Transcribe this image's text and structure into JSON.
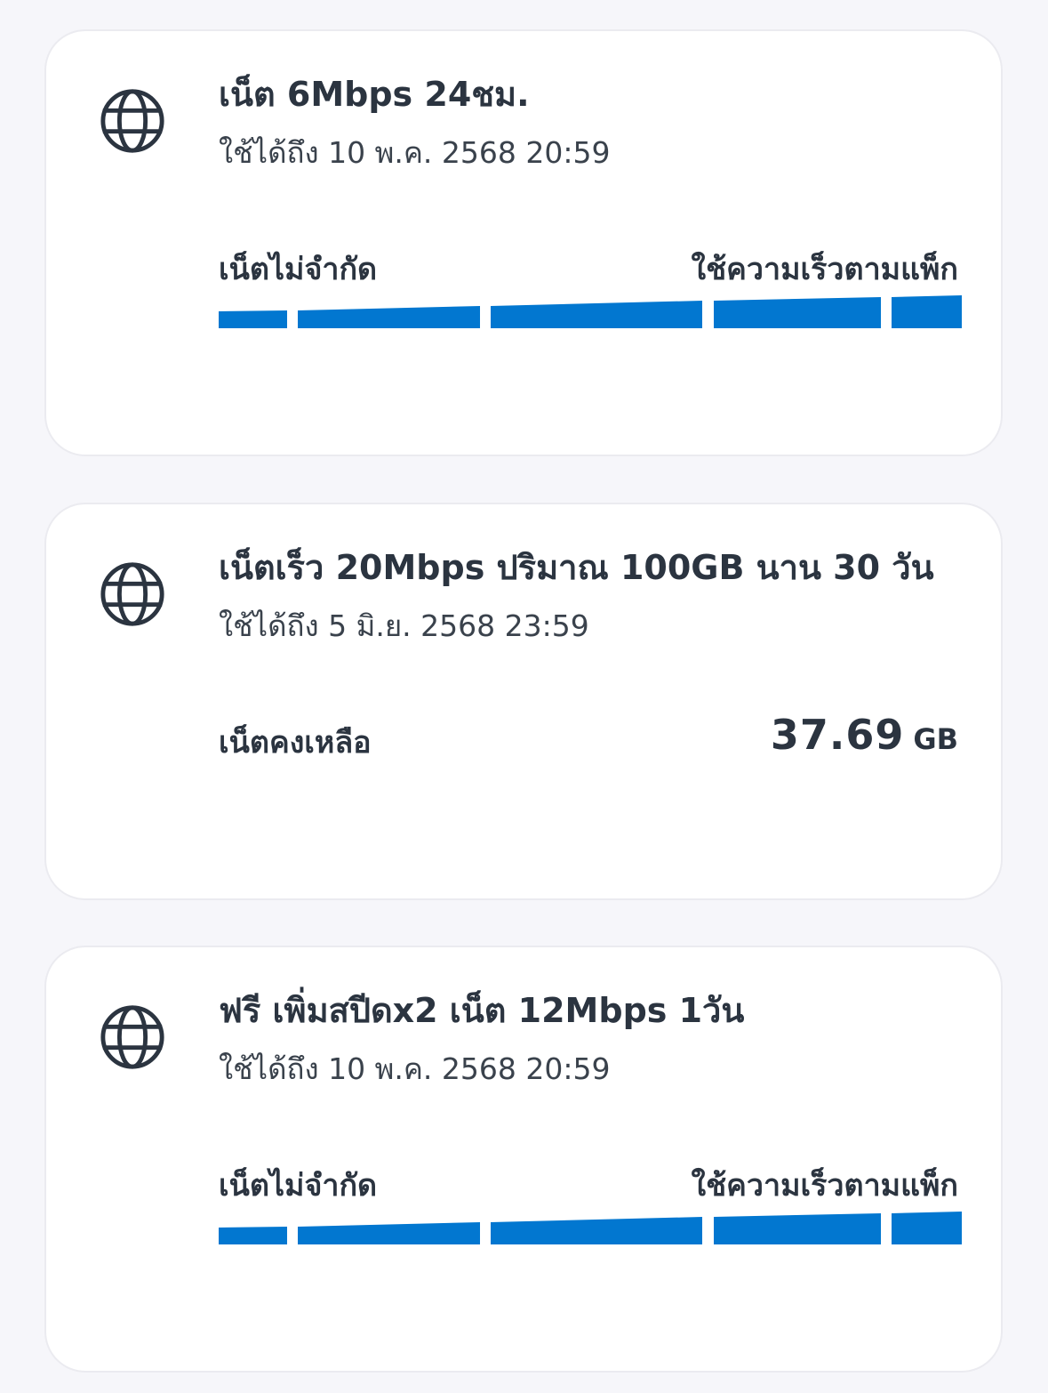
{
  "packages": [
    {
      "icon": "globe-icon",
      "title": "เน็ต 6Mbps 24ชม.",
      "valid_until": "ใช้ได้ถึง 10 พ.ค. 2568 20:59",
      "left_label": "เน็ตไม่จำกัด",
      "right_label": "ใช้ความเร็วตามแพ็ก"
    },
    {
      "icon": "globe-icon",
      "title": "เน็ตเร็ว 20Mbps ปริมาณ 100GB นาน 30 วัน",
      "valid_until": "ใช้ได้ถึง 5 มิ.ย. 2568 23:59",
      "remaining_label": "เน็ตคงเหลือ",
      "remaining_value": "37.69",
      "remaining_unit": "GB"
    },
    {
      "icon": "globe-icon",
      "title": "ฟรี เพิ่มสปีดx2 เน็ต 12Mbps 1วัน",
      "valid_until": "ใช้ได้ถึง 10 พ.ค. 2568 20:59",
      "left_label": "เน็ตไม่จำกัด",
      "right_label": "ใช้ความเร็วตามแพ็ก"
    }
  ],
  "colors": {
    "accent": "#0277d0",
    "background": "#f6f6fa",
    "card": "#ffffff",
    "text": "#2b3440"
  }
}
